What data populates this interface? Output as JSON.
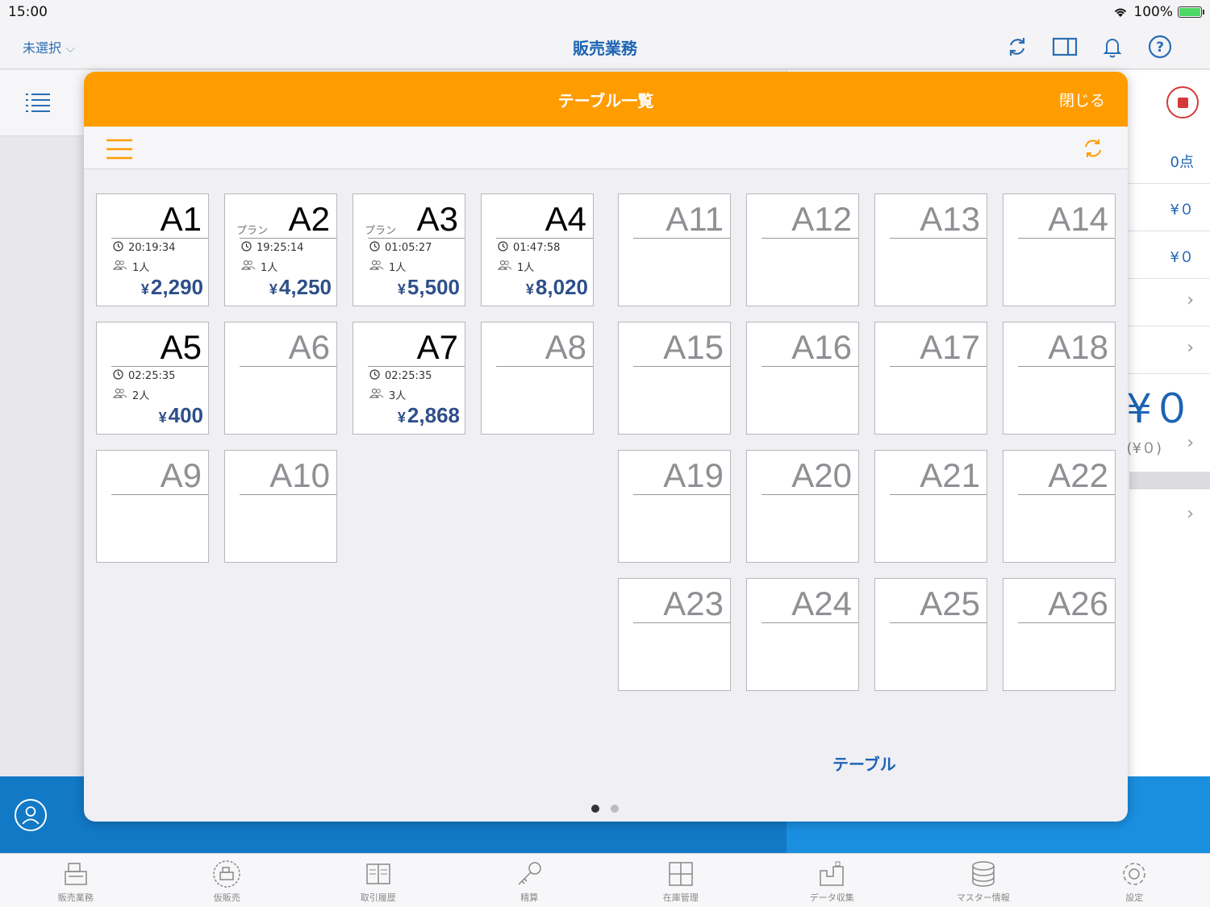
{
  "status": {
    "time": "15:00",
    "battery": "100%"
  },
  "header": {
    "selector": "未選択",
    "title": "販売業務"
  },
  "side": {
    "count": "0点",
    "amount1": "¥０",
    "amount2": "¥０",
    "total": "¥０",
    "total_sub": "(¥０)"
  },
  "modal": {
    "title": "テーブル一覧",
    "close": "閉じる",
    "page_label": "テーブル",
    "page_count": 2,
    "current_page": 1
  },
  "tables": [
    {
      "name": "A1",
      "plan": "",
      "time": "20:19:34",
      "people": "1人",
      "amount": "2,290"
    },
    {
      "name": "A2",
      "plan": "プラン",
      "time": "19:25:14",
      "people": "1人",
      "amount": "4,250"
    },
    {
      "name": "A3",
      "plan": "プラン",
      "time": "01:05:27",
      "people": "1人",
      "amount": "5,500"
    },
    {
      "name": "A4",
      "plan": "",
      "time": "01:47:58",
      "people": "1人",
      "amount": "8,020"
    },
    {
      "name": "A5",
      "plan": "",
      "time": "02:25:35",
      "people": "2人",
      "amount": "400"
    },
    {
      "name": "A6"
    },
    {
      "name": "A7",
      "plan": "",
      "time": "02:25:35",
      "people": "3人",
      "amount": "2,868"
    },
    {
      "name": "A8"
    },
    {
      "name": "A9"
    },
    {
      "name": "A10"
    },
    {
      "name": "A11"
    },
    {
      "name": "A12"
    },
    {
      "name": "A13"
    },
    {
      "name": "A14"
    },
    {
      "name": "A15"
    },
    {
      "name": "A16"
    },
    {
      "name": "A17"
    },
    {
      "name": "A18"
    },
    {
      "name": "A19"
    },
    {
      "name": "A20"
    },
    {
      "name": "A21"
    },
    {
      "name": "A22"
    },
    {
      "name": "A23"
    },
    {
      "name": "A24"
    },
    {
      "name": "A25"
    },
    {
      "name": "A26"
    }
  ],
  "currency_symbol": "¥",
  "tabs": [
    {
      "label": "販売業務",
      "icon": "register-icon"
    },
    {
      "label": "仮販売",
      "icon": "temp-register-icon"
    },
    {
      "label": "取引履歴",
      "icon": "history-icon"
    },
    {
      "label": "精算",
      "icon": "key-icon"
    },
    {
      "label": "在庫管理",
      "icon": "inventory-icon"
    },
    {
      "label": "データ収集",
      "icon": "data-collect-icon"
    },
    {
      "label": "マスター情報",
      "icon": "database-icon"
    },
    {
      "label": "設定",
      "icon": "gear-icon"
    }
  ],
  "colors": {
    "accent": "#ff9c00",
    "brand_blue": "#1d64b3",
    "amount": "#2e4f8a"
  }
}
